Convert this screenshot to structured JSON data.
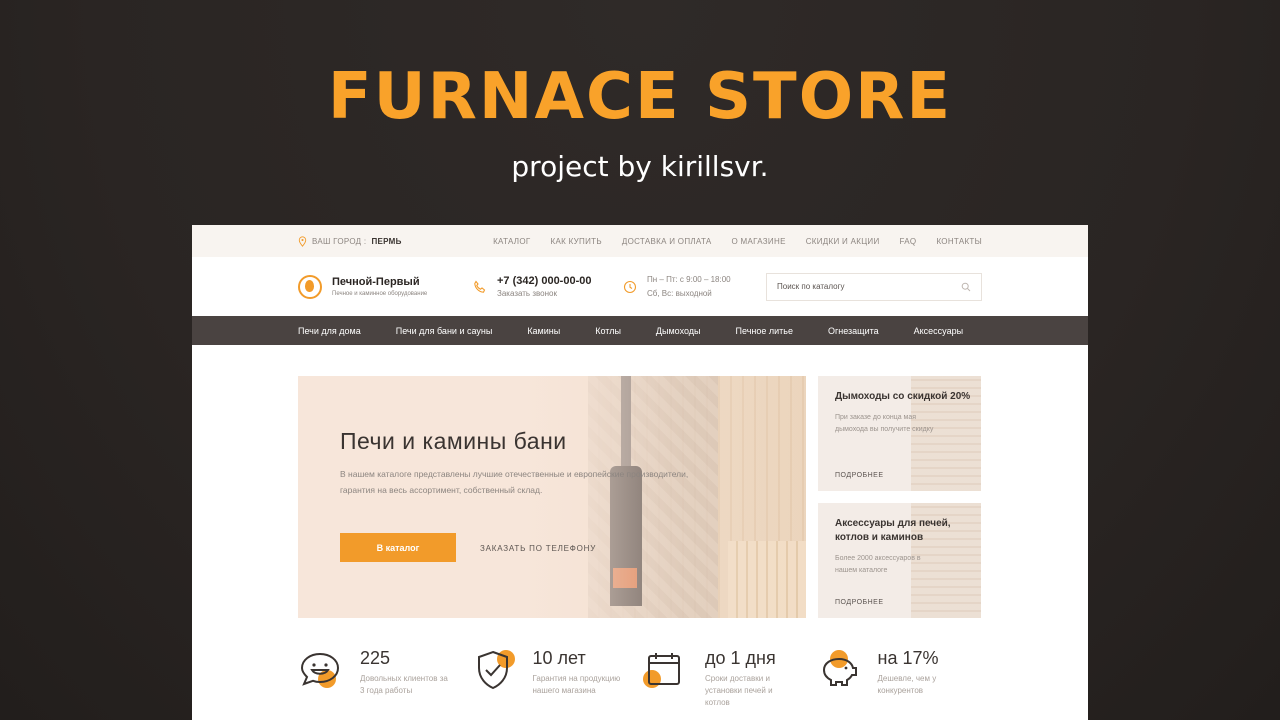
{
  "promo": {
    "title": "FURNACE STORE",
    "subtitle": "project by kirillsvr."
  },
  "topbar": {
    "city_label": "ВАШ ГОРОД :",
    "city": "ПЕРМЬ",
    "nav": [
      "КАТАЛОГ",
      "КАК КУПИТЬ",
      "ДОСТАВКА И ОПЛАТА",
      "О МАГАЗИНЕ",
      "СКИДКИ И АКЦИИ",
      "FAQ",
      "КОНТАКТЫ"
    ]
  },
  "header": {
    "logo_name": "Печной-Первый",
    "logo_tagline": "Печное и каминное оборудование",
    "phone": "+7 (342) 000-00-00",
    "callback": "Заказать звонок",
    "hours_1": "Пн – Пт: с 9:00 – 18:00",
    "hours_2": "Сб, Вс: выходной",
    "search_placeholder": "Поиск по каталогу"
  },
  "mainnav": [
    "Печи для дома",
    "Печи для бани и сауны",
    "Камины",
    "Котлы",
    "Дымоходы",
    "Печное литье",
    "Огнезащита",
    "Аксессуары"
  ],
  "hero": {
    "title": "Печи и камины бани",
    "text": "В нашем каталоге представлены лучшие отечественные и европейские производители, гарантия на весь ассортимент, собственный склад.",
    "button": "В каталог",
    "phone_link": "ЗАКАЗАТЬ ПО ТЕЛЕФОНУ"
  },
  "promos": [
    {
      "title": "Дымоходы со скидкой 20%",
      "text": "При заказе до конца мая дымохода вы получите скидку",
      "link": "ПОДРОБНЕЕ"
    },
    {
      "title": "Аксессуары для печей, котлов и каминов",
      "text": "Более 2000 аксессуаров в нашем каталоге",
      "link": "ПОДРОБНЕЕ"
    }
  ],
  "stats": [
    {
      "num": "225",
      "text": "Довольных клиентов за 3 года работы",
      "icon": "smile-chat-icon"
    },
    {
      "num": "10 лет",
      "text": "Гарантия на продукцию нашего магазина",
      "icon": "shield-check-icon"
    },
    {
      "num": "до 1 дня",
      "text": "Сроки доставки и установки печей и котлов",
      "icon": "calendar-icon"
    },
    {
      "num": "на 17%",
      "text": "Дешевле, чем у конкурентов",
      "icon": "piggy-bank-icon"
    }
  ],
  "colors": {
    "accent": "#f29b2a",
    "nav_bg": "#4a4341",
    "backdrop": "#2a2523"
  }
}
